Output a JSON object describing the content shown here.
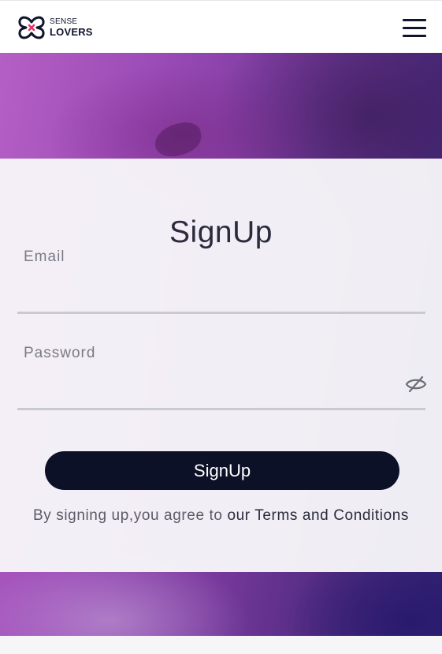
{
  "header": {
    "logo_line1": "SENSE",
    "logo_line2": "LOVERS",
    "menu_icon": "hamburger-menu-icon"
  },
  "form": {
    "title": "SignUp",
    "email_label": "Email",
    "email_value": "",
    "password_label": "Password",
    "password_value": "",
    "password_toggle_icon": "eye-slash-icon",
    "submit_label": "SignUp",
    "agree_prefix": "By signing up,you agree to ",
    "agree_link": "our Terms and Conditions"
  },
  "colors": {
    "brand_dark": "#0d1128",
    "logo_accent": "#e8336a",
    "hero_purple": "#9a4bb6"
  }
}
